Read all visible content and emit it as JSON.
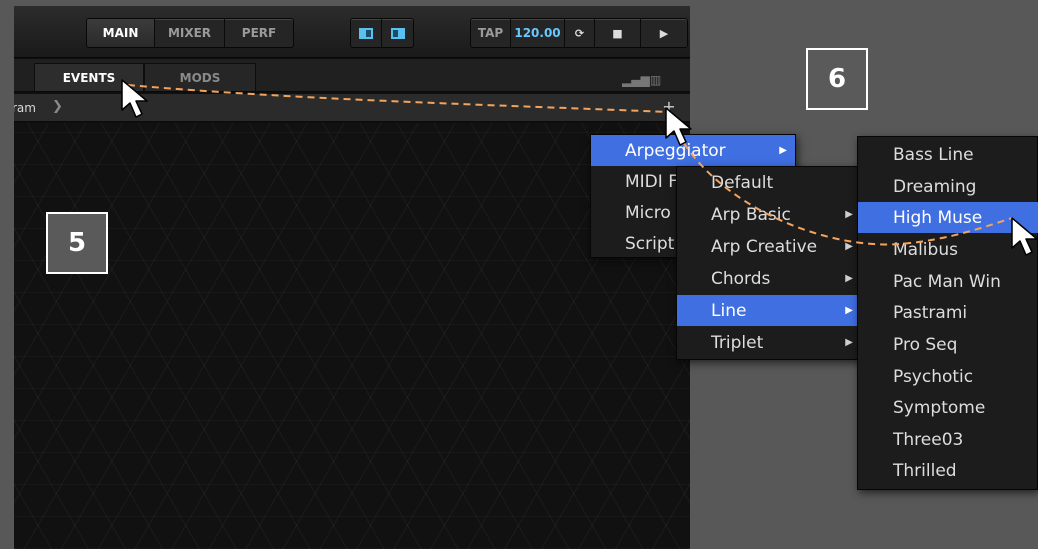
{
  "toolbar": {
    "tabs": [
      "MAIN",
      "MIXER",
      "PERF"
    ],
    "active_tab": "MAIN",
    "tap_label": "TAP",
    "tempo": "120.00",
    "sync_icon": "sync-icon",
    "stop_icon": "stop-icon",
    "play_icon": "play-icon"
  },
  "tabs": {
    "events_label": "EVENTS",
    "mods_label": "MODS",
    "active": "EVENTS"
  },
  "path": {
    "crumb": "ram",
    "add_icon": "plus-icon"
  },
  "steps": {
    "step5": "5",
    "step6": "6"
  },
  "menu1": {
    "items": [
      {
        "label": "Arpeggiator",
        "selected": true,
        "has_submenu": true
      },
      {
        "label": "MIDI F"
      },
      {
        "label": "Micro"
      },
      {
        "label": "Script"
      }
    ]
  },
  "menu2": {
    "items": [
      {
        "label": "Default"
      },
      {
        "label": "Arp Basic",
        "has_submenu": true
      },
      {
        "label": "Arp Creative",
        "has_submenu": true
      },
      {
        "label": "Chords",
        "has_submenu": true
      },
      {
        "label": "Line",
        "selected": true,
        "has_submenu": true
      },
      {
        "label": "Triplet",
        "has_submenu": true
      }
    ]
  },
  "menu3": {
    "items": [
      {
        "label": "Bass Line"
      },
      {
        "label": "Dreaming"
      },
      {
        "label": "High Muse",
        "selected": true
      },
      {
        "label": "Malibus"
      },
      {
        "label": "Pac Man Win"
      },
      {
        "label": "Pastrami"
      },
      {
        "label": "Pro Seq"
      },
      {
        "label": "Psychotic"
      },
      {
        "label": "Symptome"
      },
      {
        "label": "Three03"
      },
      {
        "label": "Thrilled"
      }
    ]
  },
  "colors": {
    "selection": "#3f6fe0",
    "annotation_path": "#f2a35e",
    "tempo": "#66c9ff"
  }
}
